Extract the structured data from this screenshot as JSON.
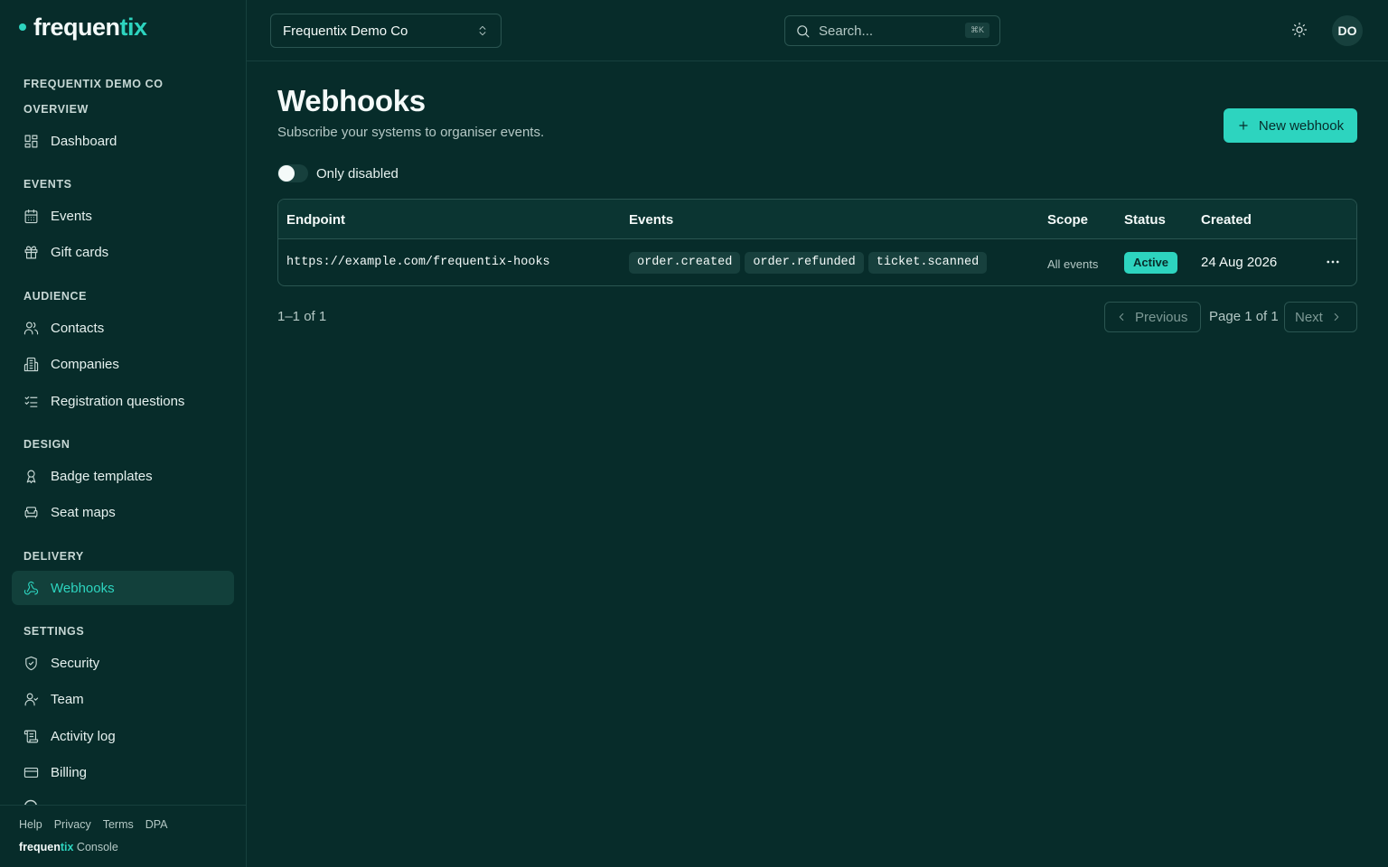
{
  "app": {
    "logo_main": "frequen",
    "logo_accent": "tix"
  },
  "sidebar": {
    "org_name": "FREQUENTIX DEMO CO",
    "sections": [
      {
        "label": "OVERVIEW",
        "items": [
          {
            "label": "Dashboard",
            "icon": "dashboard-icon"
          }
        ]
      },
      {
        "label": "EVENTS",
        "items": [
          {
            "label": "Events",
            "icon": "calendar-icon"
          },
          {
            "label": "Gift cards",
            "icon": "gift-icon"
          }
        ]
      },
      {
        "label": "AUDIENCE",
        "items": [
          {
            "label": "Contacts",
            "icon": "users-icon"
          },
          {
            "label": "Companies",
            "icon": "building-icon"
          },
          {
            "label": "Registration questions",
            "icon": "list-checks-icon"
          }
        ]
      },
      {
        "label": "DESIGN",
        "items": [
          {
            "label": "Badge templates",
            "icon": "ribbon-icon"
          },
          {
            "label": "Seat maps",
            "icon": "armchair-icon"
          }
        ]
      },
      {
        "label": "DELIVERY",
        "items": [
          {
            "label": "Webhooks",
            "icon": "webhook-icon",
            "active": true
          }
        ]
      },
      {
        "label": "SETTINGS",
        "items": [
          {
            "label": "Security",
            "icon": "shield-icon"
          },
          {
            "label": "Team",
            "icon": "user-icon"
          },
          {
            "label": "Activity log",
            "icon": "scroll-icon"
          },
          {
            "label": "Billing",
            "icon": "credit-card-icon"
          }
        ]
      }
    ],
    "footer_links": [
      "Help",
      "Privacy",
      "Terms",
      "DPA"
    ],
    "footer_brand_main": "frequen",
    "footer_brand_accent": "tix",
    "footer_brand_suffix": "Console"
  },
  "topbar": {
    "org_select": "Frequentix Demo Co",
    "search_placeholder": "Search...",
    "search_shortcut": "⌘K",
    "avatar_initials": "DO"
  },
  "page": {
    "title": "Webhooks",
    "subtitle": "Subscribe your systems to organiser events.",
    "new_button": "New webhook",
    "toggle_label": "Only disabled",
    "toggle_on": false
  },
  "table": {
    "columns": [
      "Endpoint",
      "Events",
      "Scope",
      "Status",
      "Created"
    ],
    "rows": [
      {
        "endpoint": "https://example.com/frequentix-hooks",
        "events": [
          "order.created",
          "order.refunded",
          "ticket.scanned"
        ],
        "scope": "All events",
        "status": "Active",
        "created": "24 Aug 2026"
      }
    ]
  },
  "pagination": {
    "count": "1–1 of 1",
    "previous": "Previous",
    "page_text": "Page 1 of 1",
    "next": "Next"
  },
  "colors": {
    "background": "#072c2a",
    "accent": "#2dd4bf",
    "active_nav_bg": "#12403b"
  }
}
